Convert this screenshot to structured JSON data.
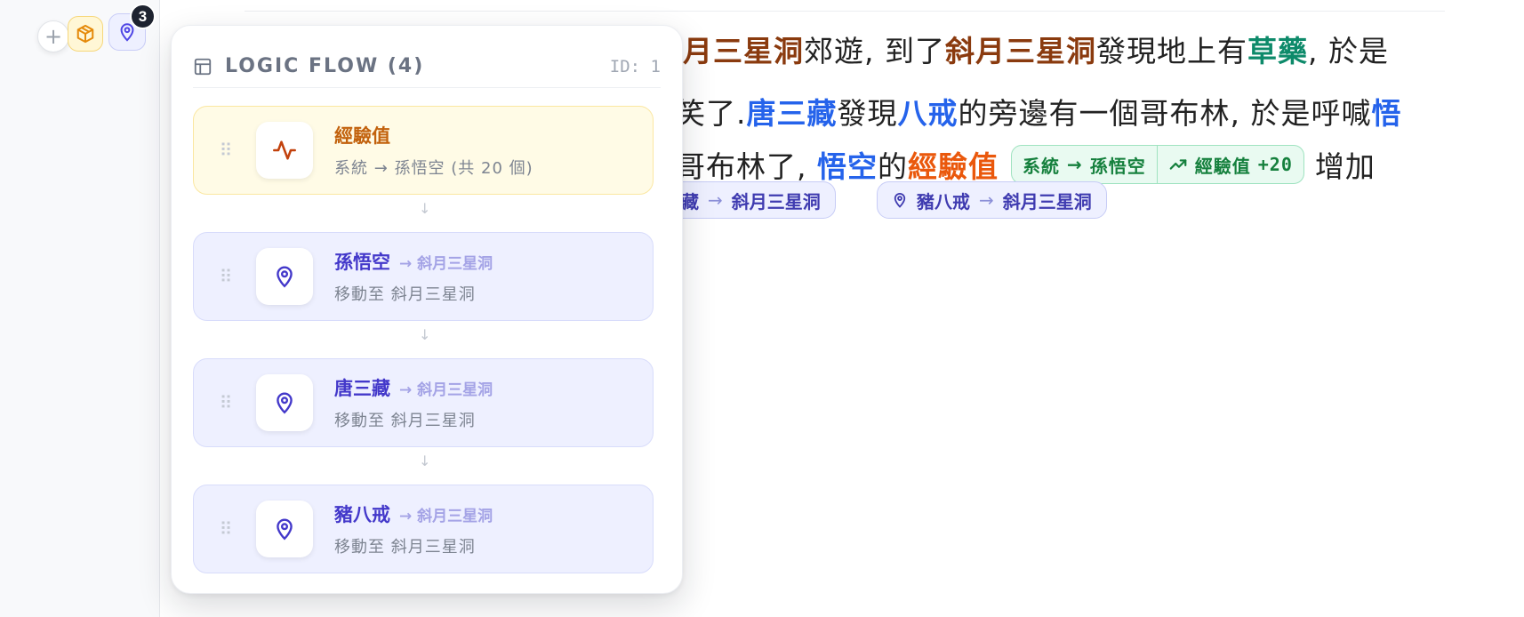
{
  "gutter": {
    "add_label": "+",
    "badge_count": "3"
  },
  "story": {
    "line1": [
      {
        "text": "斜月三星洞",
        "kind": "loc"
      },
      {
        "text": "郊遊, 到了",
        "kind": "plain"
      },
      {
        "text": "斜月三星洞",
        "kind": "loc"
      },
      {
        "text": "發現地上有",
        "kind": "plain"
      },
      {
        "text": "草藥",
        "kind": "item"
      },
      {
        "text": ", 於是",
        "kind": "plain"
      }
    ],
    "line2": [
      {
        "text": "笑了. ",
        "kind": "plain"
      },
      {
        "text": "唐三藏",
        "kind": "char"
      },
      {
        "text": "發現",
        "kind": "plain"
      },
      {
        "text": "八戒",
        "kind": "char"
      },
      {
        "text": "的旁邊有一個哥布林, 於是呼喊",
        "kind": "plain"
      },
      {
        "text": "悟",
        "kind": "char"
      }
    ],
    "line3_before": [
      {
        "text": "哥布林了, ",
        "kind": "plain"
      },
      {
        "text": "悟空",
        "kind": "char"
      },
      {
        "text": "的",
        "kind": "plain"
      },
      {
        "text": "經驗值",
        "kind": "xp"
      }
    ],
    "xp_chip": {
      "from": "系統",
      "to": "孫悟空",
      "stat": "經驗值",
      "delta": "+20"
    },
    "line3_after": "增加",
    "move_chips": [
      {
        "actor": "藏",
        "dest": "斜月三星洞"
      },
      {
        "actor": "豬八戒",
        "dest": "斜月三星洞"
      }
    ]
  },
  "panel": {
    "title": "LOGIC FLOW (4)",
    "id_label": "ID: 1",
    "cards": [
      {
        "type": "xp",
        "name": "經驗值",
        "sub": "系統 → 孫悟空 (共 20 個)"
      },
      {
        "type": "move",
        "name": "孫悟空",
        "dest": "→ 斜月三星洞",
        "sub": "移動至  斜月三星洞"
      },
      {
        "type": "move",
        "name": "唐三藏",
        "dest": "→ 斜月三星洞",
        "sub": "移動至  斜月三星洞"
      },
      {
        "type": "move",
        "name": "豬八戒",
        "dest": "→ 斜月三星洞",
        "sub": "移動至  斜月三星洞"
      }
    ],
    "connector": "↓"
  }
}
